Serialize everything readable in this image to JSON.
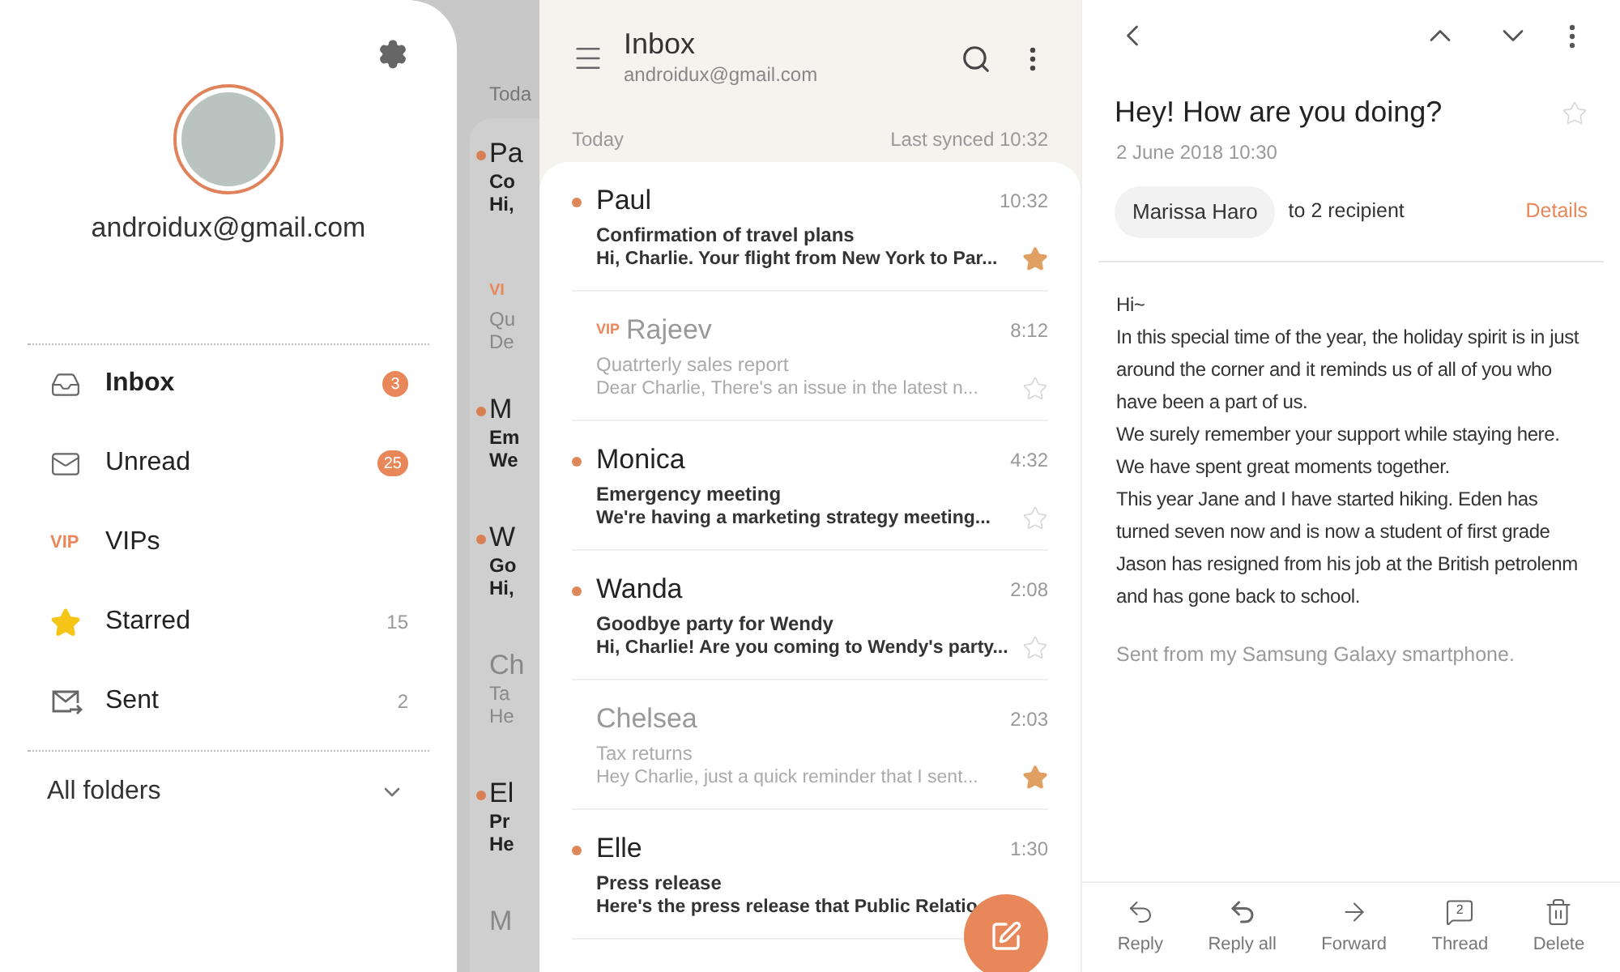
{
  "drawer": {
    "email": "androidux@gmail.com",
    "items": [
      {
        "kind": "inbox",
        "label": "Inbox",
        "count": "3",
        "badge": true,
        "selected": true
      },
      {
        "kind": "unread",
        "label": "Unread",
        "count": "25",
        "badge": true,
        "selected": false
      },
      {
        "kind": "vip",
        "icon_text": "VIP",
        "label": "VIPs",
        "selected": false
      },
      {
        "kind": "starred",
        "label": "Starred",
        "count": "15",
        "badge": false,
        "selected": false
      },
      {
        "kind": "sent",
        "label": "Sent",
        "count": "2",
        "badge": false,
        "selected": false
      }
    ],
    "all_folders": "All folders"
  },
  "behind_list": {
    "section": "Toda",
    "rows": [
      {
        "unread": true,
        "name": "Pa",
        "subject": "Co",
        "preview": "Hi,"
      },
      {
        "unread": false,
        "tag": "VI",
        "subject": "Qu",
        "preview": "De"
      },
      {
        "unread": true,
        "name": "M",
        "subject": "Em",
        "preview": "We"
      },
      {
        "unread": true,
        "name": "W",
        "subject": "Go",
        "preview": "Hi,"
      },
      {
        "unread": false,
        "name": "Ch",
        "subject": "Ta",
        "preview": "He"
      },
      {
        "unread": true,
        "name": "El",
        "subject": "Pr",
        "preview": "He"
      },
      {
        "unread": false,
        "name": "M"
      }
    ]
  },
  "inbox": {
    "title": "Inbox",
    "account": "androidux@gmail.com",
    "section": "Today",
    "synced": "Last synced 10:32",
    "rows": [
      {
        "name": "Paul",
        "time": "10:32",
        "subject": "Confirmation of travel plans",
        "preview": "Hi, Charlie. Your flight from New York to Par...",
        "unread": true,
        "starred": true
      },
      {
        "tag": "VIP",
        "name": "Rajeev",
        "time": "8:12",
        "subject": "Quatrterly sales report",
        "preview": "Dear Charlie, There's an issue in the latest n...",
        "unread": false,
        "starred": false
      },
      {
        "name": "Monica",
        "time": "4:32",
        "subject": "Emergency meeting",
        "preview": "We're having a marketing strategy meeting...",
        "unread": true,
        "starred": false
      },
      {
        "name": "Wanda",
        "time": "2:08",
        "subject": "Goodbye party for Wendy",
        "preview": "Hi, Charlie! Are you coming to Wendy's party...",
        "unread": true,
        "starred": false
      },
      {
        "name": "Chelsea",
        "time": "2:03",
        "subject": "Tax returns",
        "preview": "Hey Charlie, just a quick reminder that I sent...",
        "unread": false,
        "starred": true
      },
      {
        "name": "Elle",
        "time": "1:30",
        "subject": "Press release",
        "preview": "Here's the press release that Public Relatio",
        "unread": true
      }
    ]
  },
  "message": {
    "subject": "Hey! How are you doing?",
    "starred": false,
    "date": "2 June 2018 10:30",
    "sender": "Marissa Haro",
    "recipients": "to 2 recipient",
    "details": "Details",
    "body": [
      "Hi~",
      "In this special time of the year, the holiday spirit is in just around the corner and it reminds us of all of you who have been a part of us.",
      "We surely remember your support while staying here.",
      "We have spent great moments together.",
      "This year Jane and I have started hiking. Eden has turned seven now and is now a student of first grade",
      "Jason has resigned from his job at the British petrolenm and has gone back to school."
    ],
    "signature": "Sent from my Samsung Galaxy smartphone.",
    "actions": [
      {
        "kind": "reply",
        "label": "Reply"
      },
      {
        "kind": "reply_all",
        "label": "Reply all"
      },
      {
        "kind": "forward",
        "label": "Forward"
      },
      {
        "kind": "thread",
        "label": "Thread",
        "count": "2"
      },
      {
        "kind": "delete",
        "label": "Delete"
      }
    ]
  }
}
